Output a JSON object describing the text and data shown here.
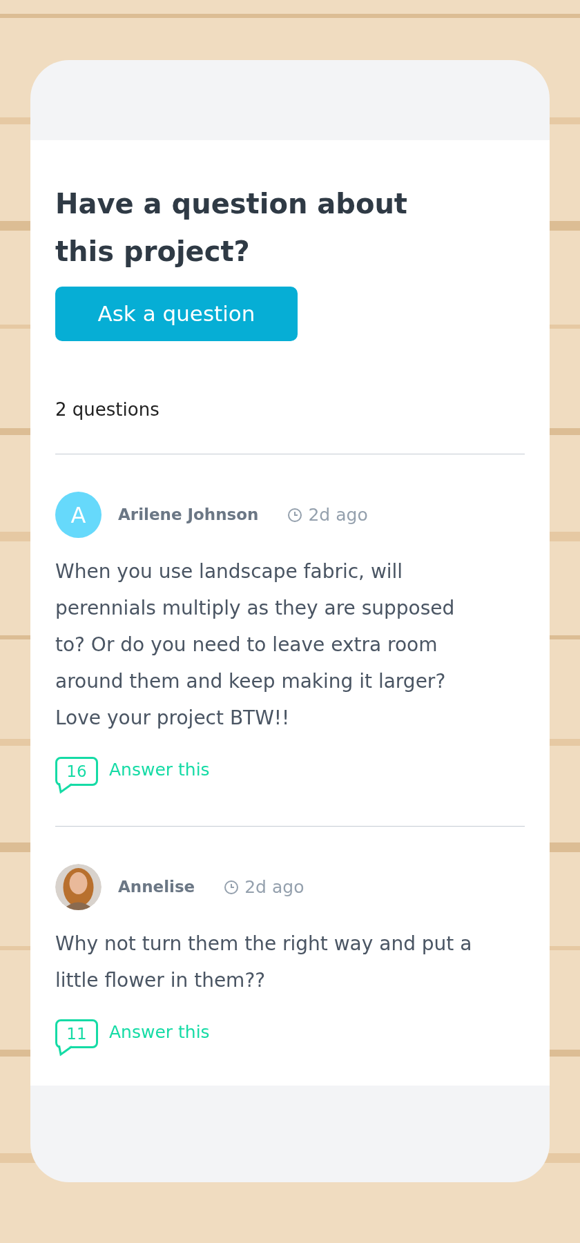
{
  "heading": "Have a question about this project?",
  "ask_button": "Ask a question",
  "question_count": "2 questions",
  "questions": [
    {
      "avatar": {
        "kind": "letter",
        "letter": "A",
        "color": "#66d9fb"
      },
      "author": "Arilene Johnson",
      "time": "2d ago",
      "text": "When you use landscape fabric, will perennials multiply as they are supposed to? Or do you need to leave extra room around them and keep making it larger? Love your project BTW!!",
      "answer_count": "16",
      "answer_link": "Answer this"
    },
    {
      "author": "Annelise",
      "time": "2d ago",
      "text": "Why not turn them the right way and put a little flower in them??",
      "answer_count": "11",
      "answer_link": "Answer this"
    }
  ]
}
